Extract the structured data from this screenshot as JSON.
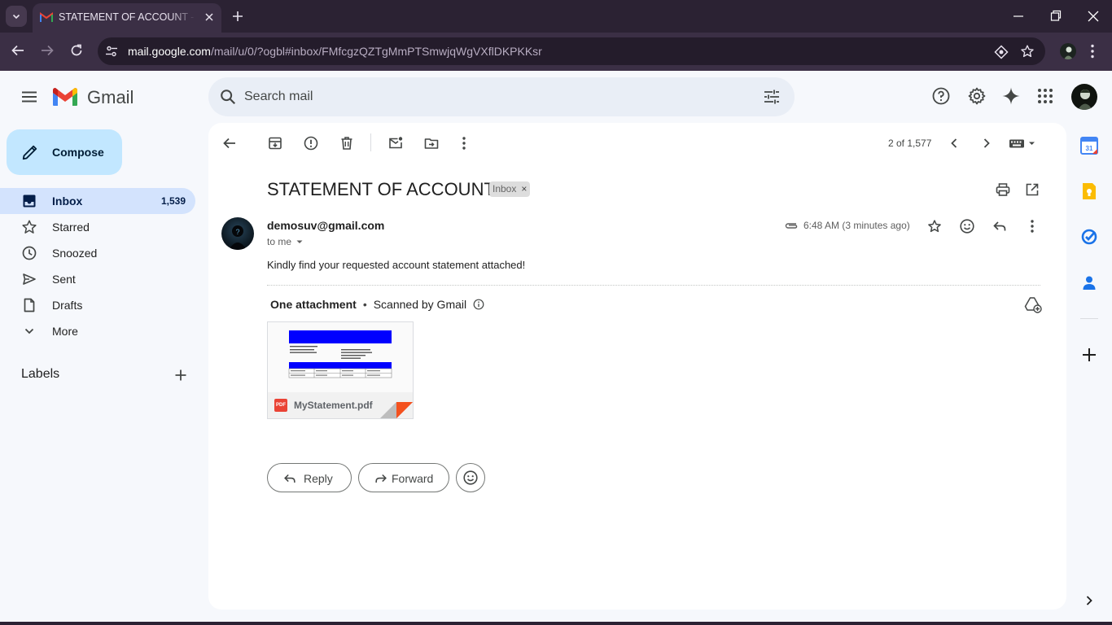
{
  "browser": {
    "tab_title": "STATEMENT OF ACCOUNT - sul",
    "url_host": "mail.google.com",
    "url_path": "/mail/u/0/?ogbl#inbox/FMfcgzQZTgMmPTSmwjqWgVXflDKPKKsr"
  },
  "header": {
    "app_name": "Gmail",
    "search_placeholder": "Search mail",
    "icons": [
      "support-icon",
      "settings-icon",
      "gemini-icon",
      "apps-icon"
    ]
  },
  "compose": {
    "label": "Compose"
  },
  "nav": {
    "items": [
      {
        "label": "Inbox",
        "count": "1,539",
        "icon": "inbox-icon",
        "active": true
      },
      {
        "label": "Starred",
        "count": "",
        "icon": "star-icon",
        "active": false
      },
      {
        "label": "Snoozed",
        "count": "",
        "icon": "clock-icon",
        "active": false
      },
      {
        "label": "Sent",
        "count": "",
        "icon": "send-icon",
        "active": false
      },
      {
        "label": "Drafts",
        "count": "",
        "icon": "draft-icon",
        "active": false
      },
      {
        "label": "More",
        "count": "",
        "icon": "chevron-down-icon",
        "active": false
      }
    ],
    "labels_heading": "Labels"
  },
  "toolbar": {
    "pager": "2 of 1,577",
    "actions": [
      "back",
      "archive",
      "report-spam",
      "delete",
      "mark-unread",
      "move-to",
      "more"
    ]
  },
  "message": {
    "subject": "STATEMENT OF ACCOUNT",
    "label_chip": "Inbox",
    "chip_remove": "×",
    "sender": "demosuv@gmail.com",
    "recipient": "to me",
    "timestamp": "6:48 AM (3 minutes ago)",
    "body": "Kindly find your requested account statement attached!",
    "attachments_count": "One attachment",
    "separator": "•",
    "scan_label": "Scanned by Gmail",
    "attachment": {
      "name": "MyStatement.pdf",
      "type": "PDF"
    }
  },
  "actions": {
    "reply": "Reply",
    "forward": "Forward"
  },
  "colors": {
    "accent": "#0b57d0",
    "compose_bg": "#c2e7ff",
    "active_nav": "#d3e3fd",
    "browser_frame": "#2b2233"
  }
}
